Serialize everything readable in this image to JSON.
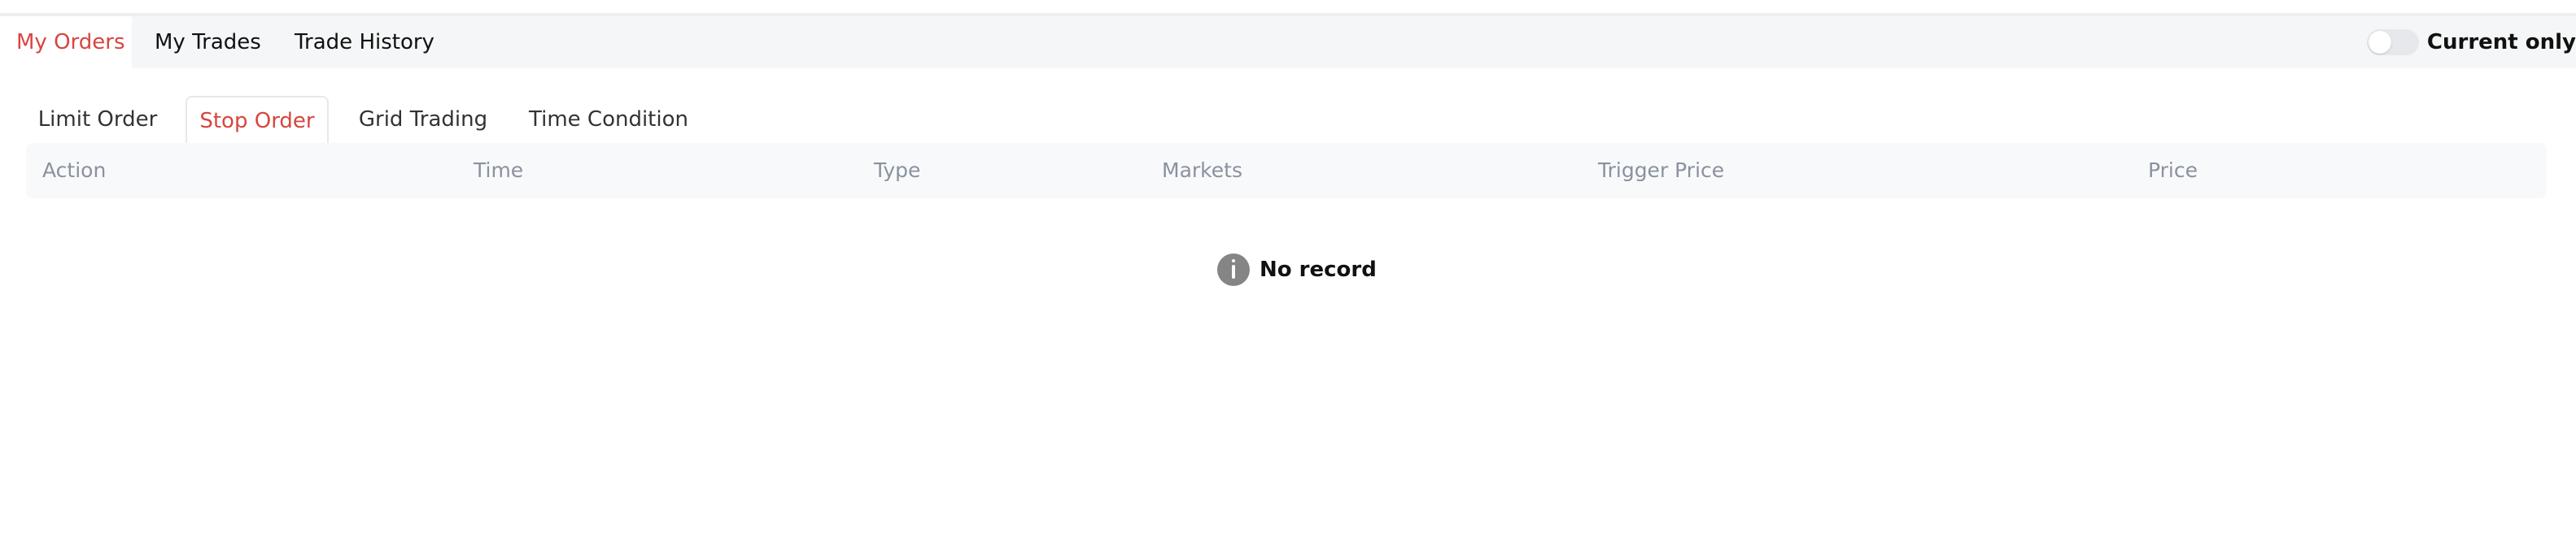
{
  "top_tabs": {
    "my_orders": "My Orders",
    "my_trades": "My Trades",
    "trade_history": "Trade History"
  },
  "current_only": {
    "label": "Current only",
    "enabled": false
  },
  "sub_tabs": {
    "limit_order": "Limit Order",
    "stop_order": "Stop Order",
    "grid_trading": "Grid Trading",
    "time_condition": "Time Condition"
  },
  "table": {
    "headers": [
      "Action",
      "Time",
      "Type",
      "Markets",
      "Trigger Price",
      "Price"
    ]
  },
  "empty_state": {
    "icon": "info-icon",
    "message": "No record"
  },
  "colors": {
    "accent": "#d6463f",
    "header_text": "#8a919f",
    "tab_background": "#f5f6f7",
    "toggle_track": "#e6e8eb",
    "info_icon": "#858585"
  }
}
